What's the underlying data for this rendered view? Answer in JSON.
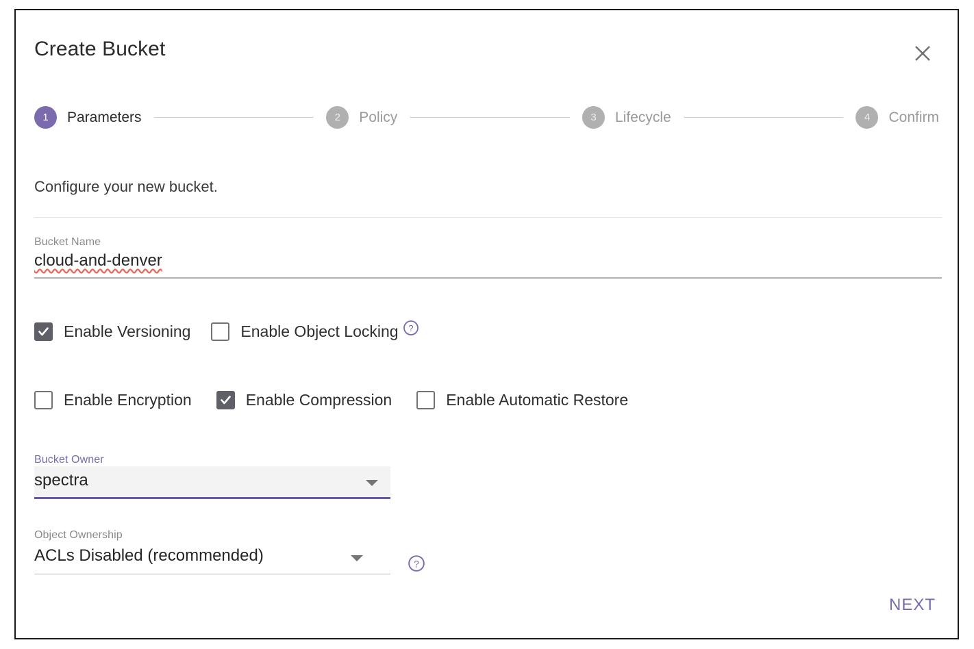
{
  "dialog": {
    "title": "Create Bucket",
    "close_icon": "close-icon",
    "description": "Configure your new bucket."
  },
  "stepper": {
    "steps": [
      {
        "number": "1",
        "label": "Parameters",
        "state": "active"
      },
      {
        "number": "2",
        "label": "Policy",
        "state": "inactive"
      },
      {
        "number": "3",
        "label": "Lifecycle",
        "state": "inactive"
      },
      {
        "number": "4",
        "label": "Confirm",
        "state": "inactive"
      }
    ]
  },
  "form": {
    "bucket_name": {
      "label": "Bucket Name",
      "value": "cloud-and-denver"
    },
    "checkbox_row_1": [
      {
        "label": "Enable Versioning",
        "checked": true,
        "help": false
      },
      {
        "label": "Enable Object Locking",
        "checked": false,
        "help": true
      }
    ],
    "checkbox_row_2": [
      {
        "label": "Enable Encryption",
        "checked": false,
        "help": false
      },
      {
        "label": "Enable Compression",
        "checked": true,
        "help": false
      },
      {
        "label": "Enable Automatic Restore",
        "checked": false,
        "help": false
      }
    ],
    "bucket_owner": {
      "label": "Bucket Owner",
      "value": "spectra",
      "focused": true
    },
    "object_ownership": {
      "label": "Object Ownership",
      "value": "ACLs Disabled (recommended)",
      "focused": false,
      "help": true
    }
  },
  "footer": {
    "next_label": "NEXT"
  },
  "colors": {
    "accent_purple": "#7b6aad",
    "focus_underline": "#6a57a8",
    "checkbox_checked": "#5f5f67",
    "inactive_gray": "#b0b0b0",
    "spellcheck_red": "#e8695b"
  }
}
